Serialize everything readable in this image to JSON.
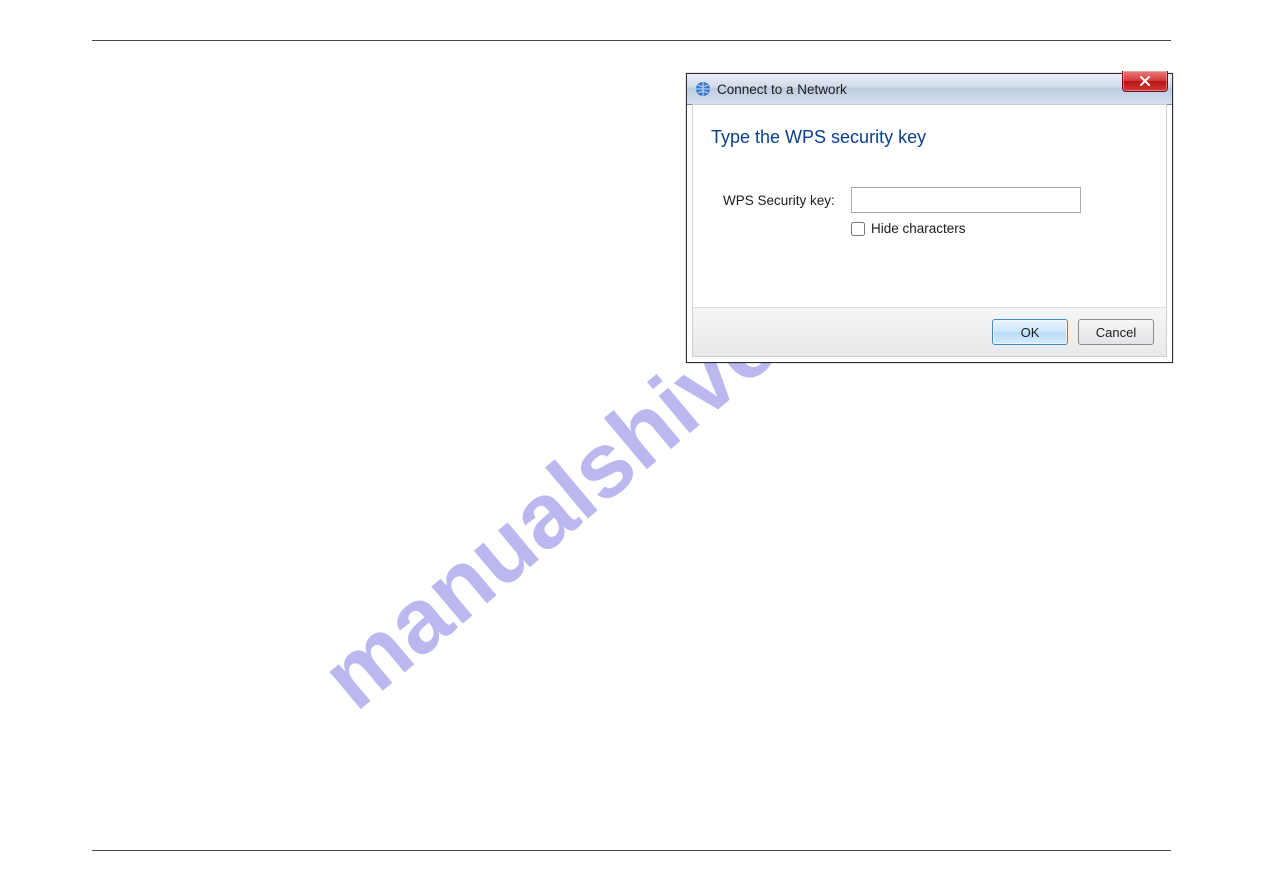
{
  "watermark": "manualshive.com",
  "dialog": {
    "title": "Connect to a Network",
    "heading": "Type the WPS security key",
    "field_label": "WPS Security key:",
    "input_value": "",
    "hide_characters_label": "Hide characters",
    "hide_characters_checked": false,
    "ok_label": "OK",
    "cancel_label": "Cancel"
  }
}
